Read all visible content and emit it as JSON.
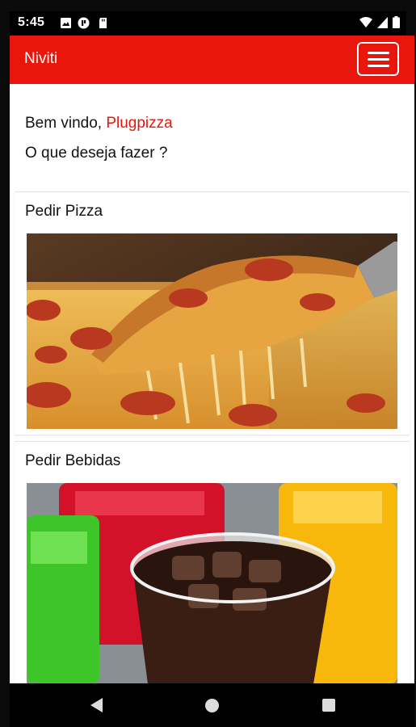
{
  "status_bar": {
    "time": "5:45",
    "icons": [
      "image-icon",
      "recording-icon",
      "sdcard-icon",
      "wifi-icon",
      "signal-icon",
      "battery-icon"
    ]
  },
  "app_bar": {
    "title": "Niviti",
    "menu_icon": "hamburger-menu-icon",
    "background_color": "#e8160c"
  },
  "welcome": {
    "greeting": "Bem vindo,",
    "user": "Plugpizza",
    "question": "O que deseja fazer ?"
  },
  "cards": [
    {
      "title": "Pedir Pizza",
      "image": "pizza-photo"
    },
    {
      "title": "Pedir Bebidas",
      "image": "drinks-photo"
    }
  ],
  "nav_bar": {
    "icons": [
      "back-icon",
      "home-icon",
      "recents-icon"
    ]
  }
}
